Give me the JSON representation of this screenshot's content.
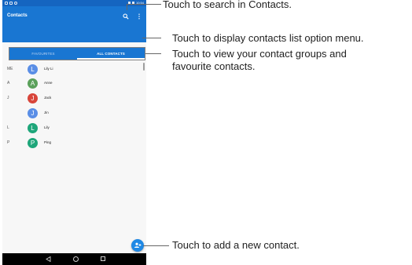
{
  "app": {
    "title": "Contacts",
    "status_time": "10:54"
  },
  "tabs": [
    {
      "label": "FAVOURITES",
      "active": false
    },
    {
      "label": "ALL CONTACTS",
      "active": true
    }
  ],
  "contacts": [
    {
      "section": "ME",
      "initial": "L",
      "name": "Lily Li",
      "color": "#5a8ee6"
    },
    {
      "section": "A",
      "initial": "A",
      "name": "Anne",
      "color": "#5aa05a"
    },
    {
      "section": "J",
      "initial": "J",
      "name": "Jack",
      "color": "#d8453a"
    },
    {
      "section": "",
      "initial": "J",
      "name": "Jin",
      "color": "#5a8ee6"
    },
    {
      "section": "L",
      "initial": "L",
      "name": "Lily",
      "color": "#1ea67a"
    },
    {
      "section": "P",
      "initial": "P",
      "name": "Ping",
      "color": "#1ea67a"
    }
  ],
  "callouts": {
    "search": "Touch to search in Contacts.",
    "menu": "Touch to display contacts list option menu.",
    "groups_line1": "Touch to view your contact groups and",
    "groups_line2": "favourite contacts.",
    "add": "Touch to add a new contact."
  },
  "icons": {
    "search": "search-icon",
    "menu": "more-vert-icon",
    "add": "add-contact-icon",
    "back": "back-icon",
    "home": "home-icon",
    "recent": "recent-apps-icon"
  },
  "colors": {
    "app_bar": "#1976d2",
    "status_bar": "#1565c0",
    "fab": "#1e88e5"
  }
}
